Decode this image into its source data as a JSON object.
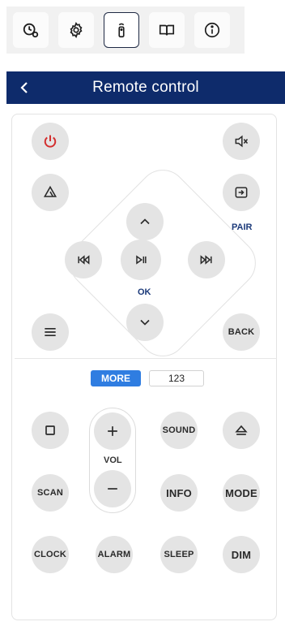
{
  "toolbar": {
    "items": [
      {
        "icon": "clock-settings-icon"
      },
      {
        "icon": "gear-icon"
      },
      {
        "icon": "remote-icon",
        "active": true
      },
      {
        "icon": "book-icon"
      },
      {
        "icon": "info-icon"
      }
    ]
  },
  "header": {
    "back_icon": "chevron-left-icon",
    "title": "Remote control"
  },
  "remote": {
    "pair_label": "PAIR",
    "ok_label": "OK",
    "back_label": "BACK",
    "tabs": {
      "more": "MORE",
      "numbers": "123"
    },
    "vol_label": "VOL",
    "sound_label": "SOUND",
    "scan_label": "SCAN",
    "info_label": "INFO",
    "mode_label": "MODE",
    "clock_label": "CLOCK",
    "alarm_label": "ALARM",
    "sleep_label": "SLEEP",
    "dim_label": "DIM"
  },
  "colors": {
    "header_bg": "#0e2b6b",
    "power_red": "#d32f2f",
    "accent_blue": "#2f7de1",
    "label_blue": "#1c3a7a",
    "button_gray": "#e4e4e4"
  }
}
